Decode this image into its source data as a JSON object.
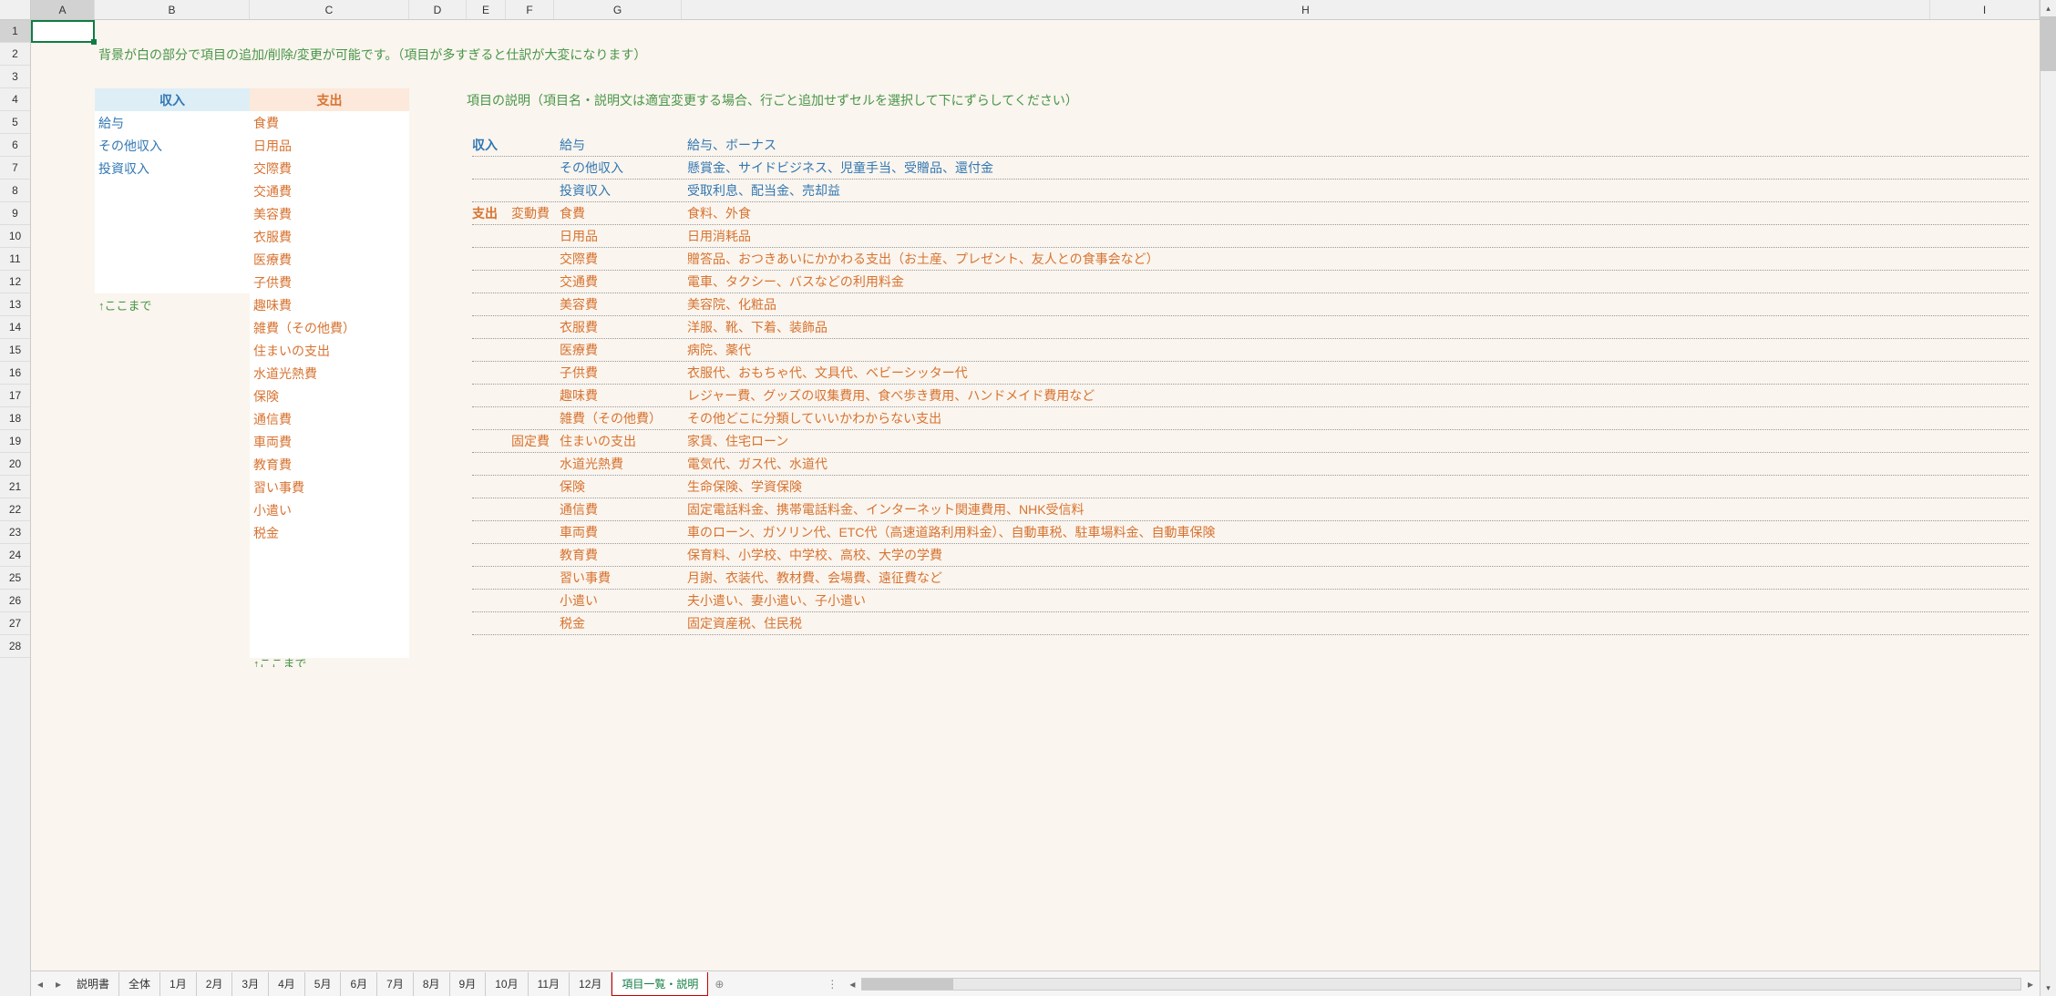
{
  "columns": [
    "A",
    "B",
    "C",
    "D",
    "E",
    "F",
    "G",
    "H",
    "I"
  ],
  "rows": [
    1,
    2,
    3,
    4,
    5,
    6,
    7,
    8,
    9,
    10,
    11,
    12,
    13,
    14,
    15,
    16,
    17,
    18,
    19,
    20,
    21,
    22,
    23,
    24,
    25,
    26,
    27,
    28
  ],
  "note": "背景が白の部分で項目の追加/削除/変更が可能です。（項目が多すぎると仕訳が大変になります）",
  "income_header": "収入",
  "expense_header": "支出",
  "income_items": [
    "給与",
    "その他収入",
    "投資収入"
  ],
  "expense_items": [
    "食費",
    "日用品",
    "交際費",
    "交通費",
    "美容費",
    "衣服費",
    "医療費",
    "子供費",
    "趣味費",
    "雑費（その他費）",
    "住まいの支出",
    "水道光熱費",
    "保険",
    "通信費",
    "車両費",
    "教育費",
    "習い事費",
    "小遣い",
    "税金"
  ],
  "arrow_note": "↑ここまで",
  "arrow_note2": "↑ここまで",
  "desc_title": "項目の説明（項目名・説明文は適宜変更する場合、行ごと追加せずセルを選択して下にずらしてください）",
  "desc_income_label": "収入",
  "desc_expense_label": "支出",
  "desc_variable": "変動費",
  "desc_fixed": "固定費",
  "descriptions": [
    {
      "cat": "income",
      "label": "収入",
      "sub": "",
      "name": "給与",
      "text": "給与、ボーナス"
    },
    {
      "cat": "income",
      "label": "",
      "sub": "",
      "name": "その他収入",
      "text": "懸賞金、サイドビジネス、児童手当、受贈品、還付金"
    },
    {
      "cat": "income",
      "label": "",
      "sub": "",
      "name": "投資収入",
      "text": "受取利息、配当金、売却益"
    },
    {
      "cat": "expense",
      "label": "支出",
      "sub": "変動費",
      "name": "食費",
      "text": "食料、外食"
    },
    {
      "cat": "expense",
      "label": "",
      "sub": "",
      "name": "日用品",
      "text": "日用消耗品"
    },
    {
      "cat": "expense",
      "label": "",
      "sub": "",
      "name": "交際費",
      "text": "贈答品、おつきあいにかかわる支出（お土産、プレゼント、友人との食事会など）"
    },
    {
      "cat": "expense",
      "label": "",
      "sub": "",
      "name": "交通費",
      "text": "電車、タクシー、バスなどの利用料金"
    },
    {
      "cat": "expense",
      "label": "",
      "sub": "",
      "name": "美容費",
      "text": "美容院、化粧品"
    },
    {
      "cat": "expense",
      "label": "",
      "sub": "",
      "name": "衣服費",
      "text": "洋服、靴、下着、装飾品"
    },
    {
      "cat": "expense",
      "label": "",
      "sub": "",
      "name": "医療費",
      "text": "病院、薬代"
    },
    {
      "cat": "expense",
      "label": "",
      "sub": "",
      "name": "子供費",
      "text": "衣服代、おもちゃ代、文具代、ベビーシッター代"
    },
    {
      "cat": "expense",
      "label": "",
      "sub": "",
      "name": "趣味費",
      "text": "レジャー費、グッズの収集費用、食べ歩き費用、ハンドメイド費用など"
    },
    {
      "cat": "expense",
      "label": "",
      "sub": "",
      "name": "雑費（その他費）",
      "text": "その他どこに分類していいかわからない支出"
    },
    {
      "cat": "expense",
      "label": "",
      "sub": "固定費",
      "name": "住まいの支出",
      "text": "家賃、住宅ローン"
    },
    {
      "cat": "expense",
      "label": "",
      "sub": "",
      "name": "水道光熱費",
      "text": "電気代、ガス代、水道代"
    },
    {
      "cat": "expense",
      "label": "",
      "sub": "",
      "name": "保険",
      "text": "生命保険、学資保険"
    },
    {
      "cat": "expense",
      "label": "",
      "sub": "",
      "name": "通信費",
      "text": "固定電話料金、携帯電話料金、インターネット関連費用、NHK受信料"
    },
    {
      "cat": "expense",
      "label": "",
      "sub": "",
      "name": "車両費",
      "text": "車のローン、ガソリン代、ETC代（高速道路利用料金）、自動車税、駐車場料金、自動車保険"
    },
    {
      "cat": "expense",
      "label": "",
      "sub": "",
      "name": "教育費",
      "text": "保育料、小学校、中学校、高校、大学の学費"
    },
    {
      "cat": "expense",
      "label": "",
      "sub": "",
      "name": "習い事費",
      "text": "月謝、衣装代、教材費、会場費、遠征費など"
    },
    {
      "cat": "expense",
      "label": "",
      "sub": "",
      "name": "小遣い",
      "text": "夫小遣い、妻小遣い、子小遣い"
    },
    {
      "cat": "expense",
      "label": "",
      "sub": "",
      "name": "税金",
      "text": "固定資産税、住民税"
    }
  ],
  "tabs": [
    "説明書",
    "全体",
    "1月",
    "2月",
    "3月",
    "4月",
    "5月",
    "6月",
    "7月",
    "8月",
    "9月",
    "10月",
    "11月",
    "12月",
    "項目一覧・説明"
  ],
  "active_tab": "項目一覧・説明"
}
